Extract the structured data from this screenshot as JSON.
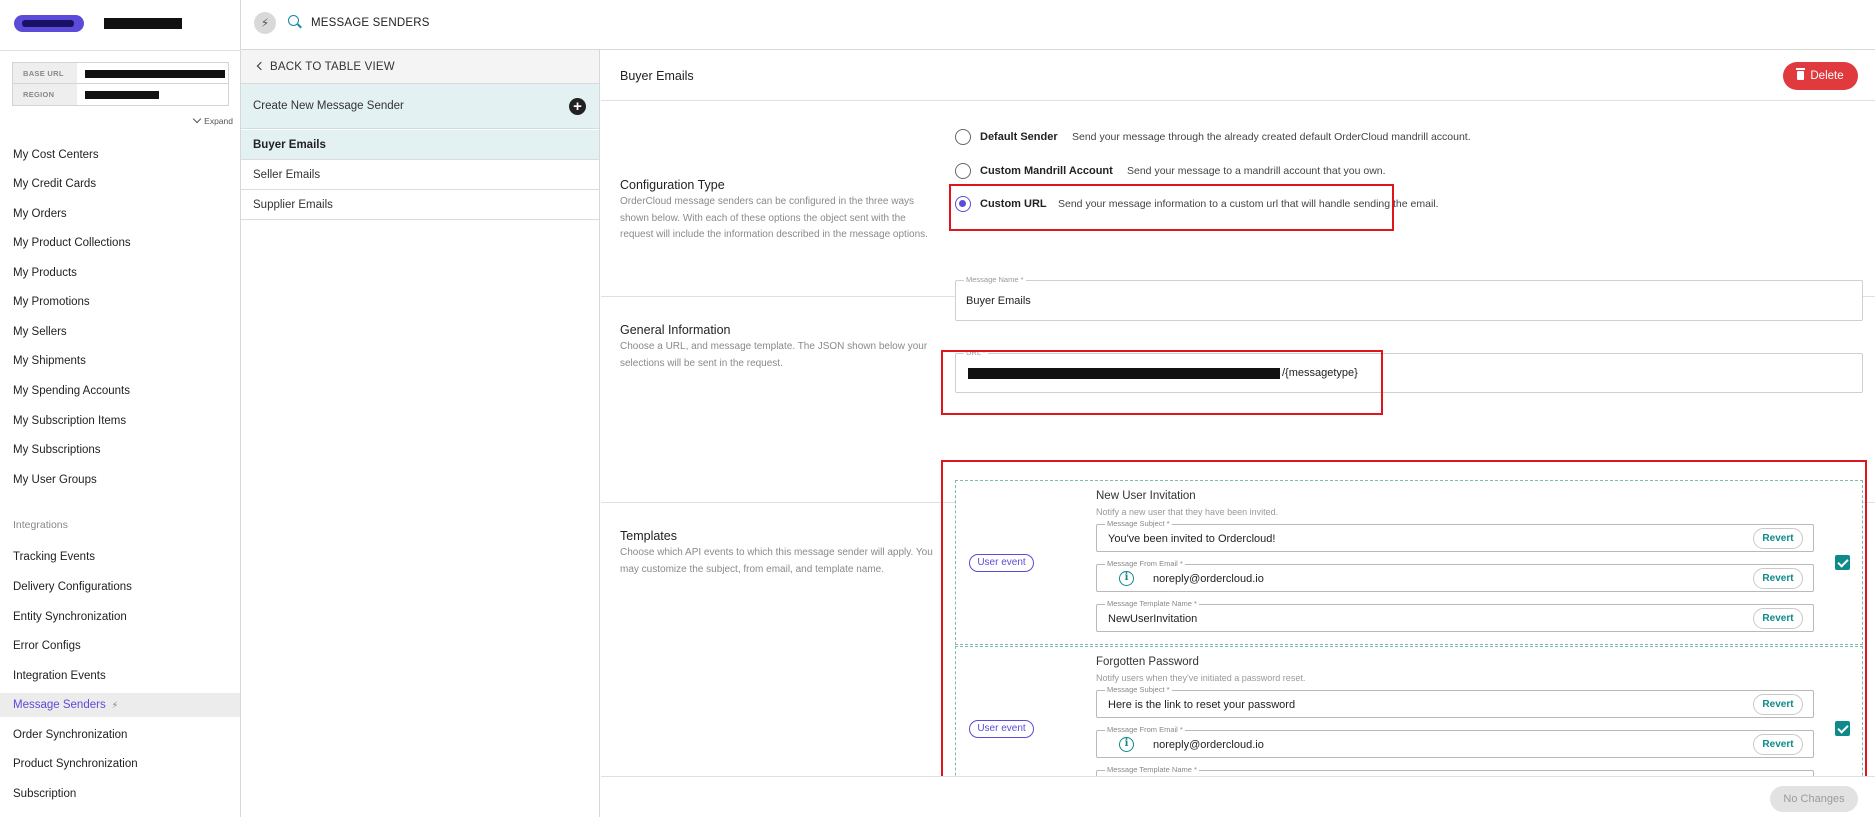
{
  "topbar": {
    "title": "MESSAGE SENDERS"
  },
  "sidebar": {
    "env_labels": {
      "base_url": "BASE URL",
      "region": "REGION"
    },
    "expand_label": "Expand",
    "items": [
      "My Cost Centers",
      "My Credit Cards",
      "My Orders",
      "My Product Collections",
      "My Products",
      "My Promotions",
      "My Sellers",
      "My Shipments",
      "My Spending Accounts",
      "My Subscription Items",
      "My Subscriptions",
      "My User Groups"
    ],
    "section_integrations": "Integrations",
    "integration_items": [
      "Tracking Events",
      "Delivery Configurations",
      "Entity Synchronization",
      "Error Configs",
      "Integration Events",
      "Message Senders",
      "Order Synchronization",
      "Product Synchronization",
      "Subscription"
    ]
  },
  "midpanel": {
    "back_label": "BACK TO TABLE VIEW",
    "create_label": "Create New Message Sender",
    "list": [
      "Buyer Emails",
      "Seller Emails",
      "Supplier Emails"
    ]
  },
  "main": {
    "title": "Buyer Emails",
    "delete_label": "Delete",
    "config": {
      "title": "Configuration Type",
      "desc": "OrderCloud message senders can be configured in the three ways shown below. With each of these options the object sent with the request will include the information described in the message options.",
      "options": [
        {
          "label": "Default Sender",
          "desc": "Send your message through the already created default OrderCloud mandrill account."
        },
        {
          "label": "Custom Mandrill Account",
          "desc": "Send your message to a mandrill account that you own."
        },
        {
          "label": "Custom URL",
          "desc": "Send your message information to a custom url that will handle sending the email."
        }
      ],
      "selected": "Custom URL"
    },
    "general": {
      "title": "General Information",
      "desc": "Choose a URL, and message template. The JSON shown below your selections will be sent in the request.",
      "message_name_label": "Message Name *",
      "message_name_value": "Buyer Emails",
      "url_label": "URL *",
      "url_suffix": "/{messagetype}"
    },
    "templates": {
      "title": "Templates",
      "desc": "Choose which API events to which this message sender will apply. You may customize the subject, from email, and template name.",
      "subject_label": "Message Subject *",
      "from_label": "Message From Email *",
      "template_label": "Message Template Name *",
      "revert_label": "Revert",
      "items": [
        {
          "event": "User event",
          "name": "New User Invitation",
          "desc": "Notify a new user that they have been invited.",
          "subject": "You've been invited to Ordercloud!",
          "from": "noreply@ordercloud.io",
          "template": "NewUserInvitation",
          "checked": true
        },
        {
          "event": "User event",
          "name": "Forgotten Password",
          "desc": "Notify users when they've initiated a password reset.",
          "subject": "Here is the link to reset your password",
          "from": "noreply@ordercloud.io",
          "template": "",
          "checked": true
        }
      ]
    },
    "footer": {
      "no_changes_label": "No Changes"
    }
  }
}
